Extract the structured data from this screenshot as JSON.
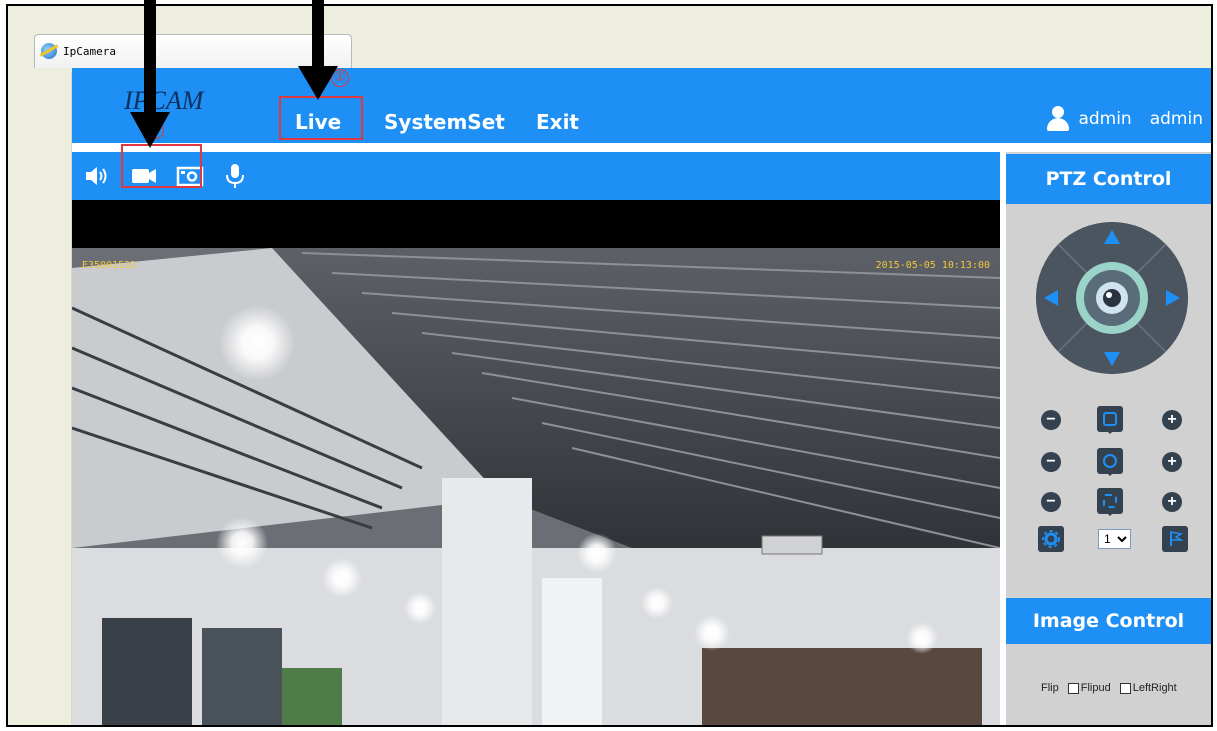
{
  "browser": {
    "tab_title": "IpCamera"
  },
  "header": {
    "logo": "IPCAM",
    "nav": [
      "Live",
      "SystemSet",
      "Exit"
    ],
    "user_name": "admin",
    "user_role": "admin"
  },
  "video": {
    "osd_id": "E35001532",
    "osd_time": "2015-05-05 10:13:00"
  },
  "toolbar": {
    "icons": [
      "speaker-icon",
      "record-video-icon",
      "snapshot-icon",
      "microphone-icon"
    ]
  },
  "ptz": {
    "title": "PTZ Control",
    "zoom_minus": "−",
    "zoom_plus": "+",
    "preset_value": "1",
    "preset_options": [
      "1"
    ]
  },
  "image_control": {
    "title": "Image Control",
    "flip_label": "Flip",
    "flipud_label": "Flipud",
    "leftright_label": "LeftRight"
  },
  "annotations": {
    "num1": "①",
    "num2": "②"
  },
  "colors": {
    "brand_blue": "#1e90f5",
    "panel_gray": "#d1d1d1",
    "annotation_red": "#e0383d",
    "ptz_dark": "#344250"
  }
}
